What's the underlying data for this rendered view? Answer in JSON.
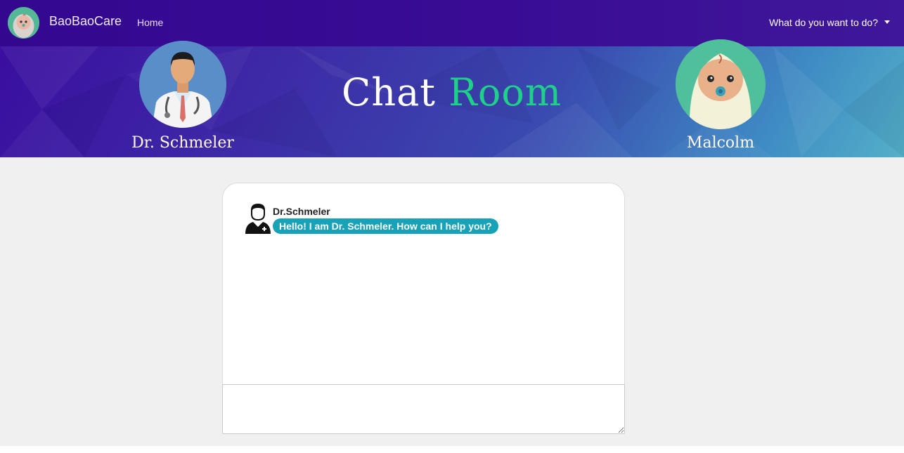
{
  "navbar": {
    "brand_name": "BaoBaoCare",
    "home_link": "Home",
    "dropdown_label": "What do you want to do?"
  },
  "banner": {
    "title_part1": "Chat",
    "title_part2": "Room",
    "doctor_name": "Dr. Schmeler",
    "baby_name": "Malcolm"
  },
  "chat": {
    "messages": [
      {
        "sender": "Dr.Schmeler",
        "text": "Hello! I am Dr. Schmeler. How can I help you?"
      }
    ],
    "input_value": ""
  },
  "colors": {
    "navbar_bg": "#33088f",
    "accent_room": "#1fd08a",
    "bubble": "#17a2b8",
    "page_bg": "#f0f0f0"
  }
}
